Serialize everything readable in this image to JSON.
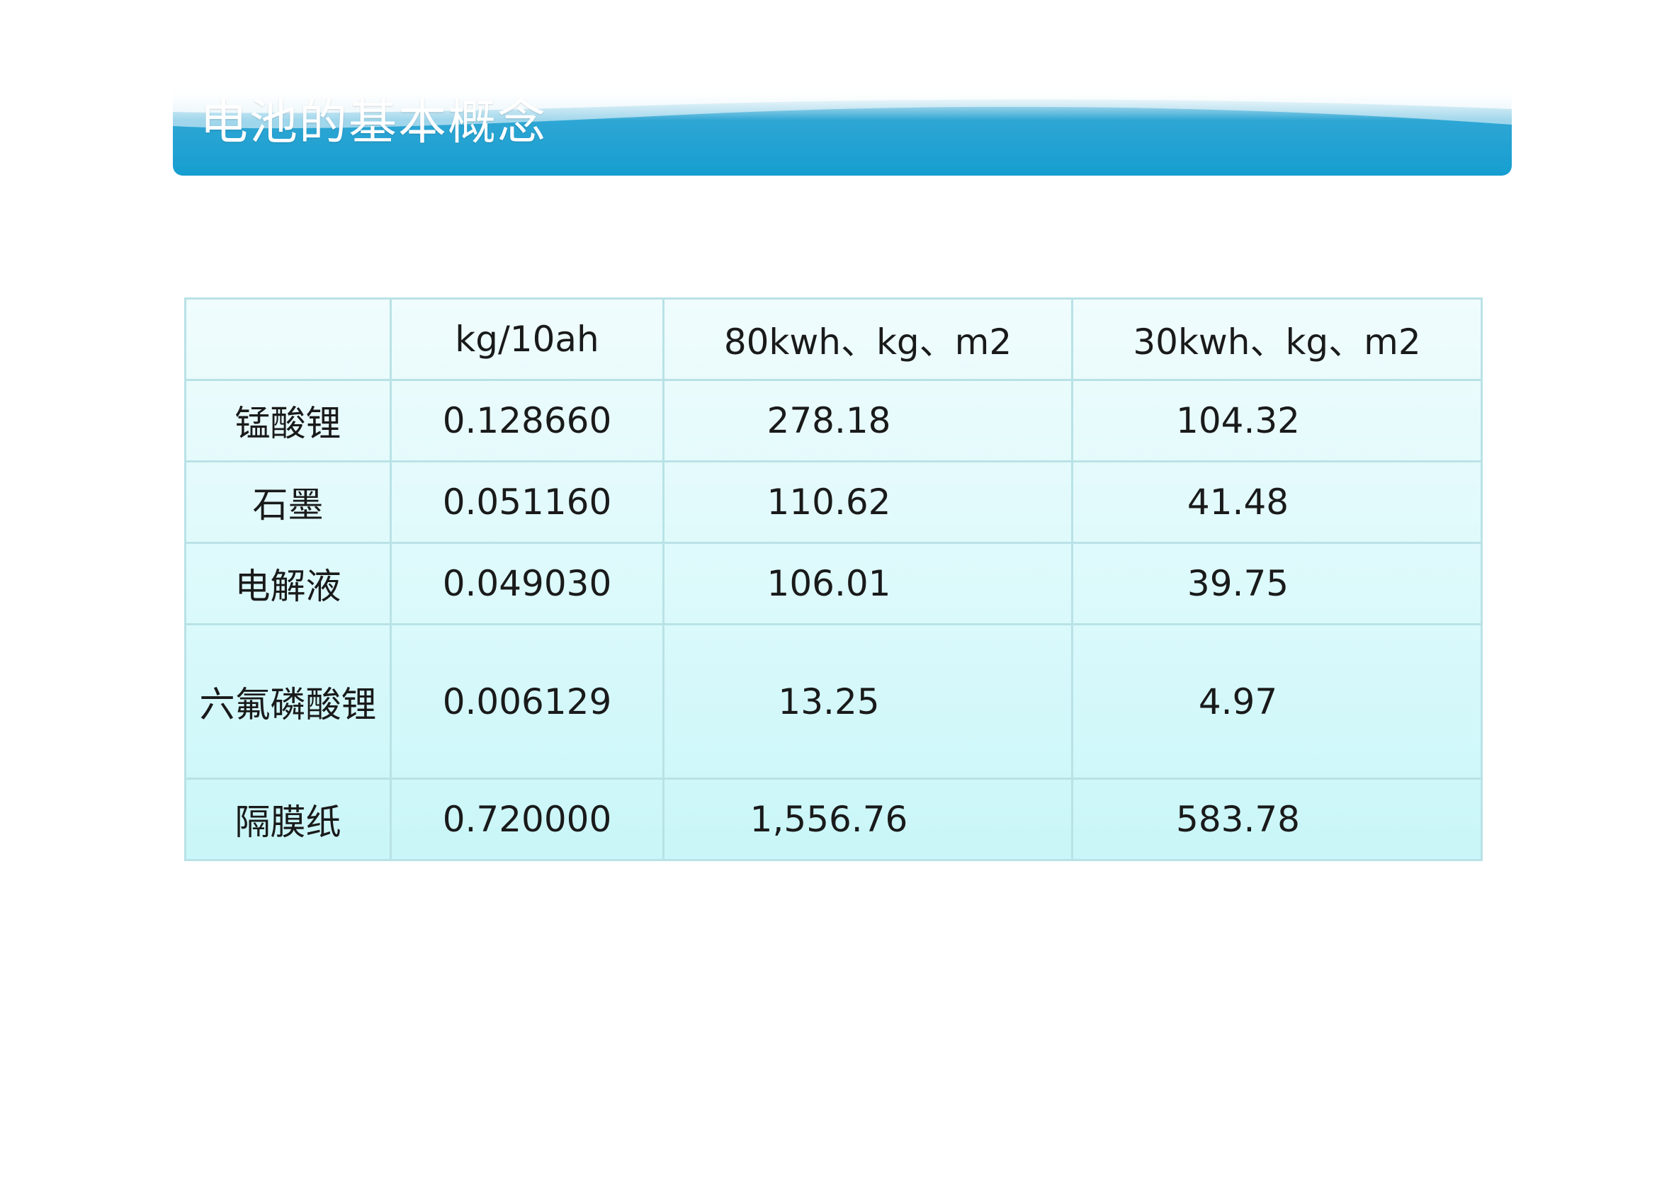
{
  "header": {
    "title": "电池的基本概念"
  },
  "table": {
    "columns": [
      "",
      "kg/10ah",
      "80kwh、kg、m2",
      "30kwh、kg、m2"
    ],
    "rows": [
      {
        "name": "锰酸锂",
        "kg_per_10ah": "0.128660",
        "kwh80": "278.18",
        "kwh30": "104.32"
      },
      {
        "name": "石墨",
        "kg_per_10ah": "0.051160",
        "kwh80": "110.62",
        "kwh30": "41.48"
      },
      {
        "name": "电解液",
        "kg_per_10ah": "0.049030",
        "kwh80": "106.01",
        "kwh30": "39.75"
      },
      {
        "name": "六氟磷酸锂",
        "kg_per_10ah": "0.006129",
        "kwh80": "13.25",
        "kwh30": "4.97"
      },
      {
        "name": "隔膜纸",
        "kg_per_10ah": "0.720000",
        "kwh80": "1,556.76",
        "kwh30": "583.78"
      }
    ]
  },
  "colors": {
    "banner_blue": "#159ed0",
    "table_border": "#b9e2e6",
    "table_fill": "#d9f9fb"
  }
}
